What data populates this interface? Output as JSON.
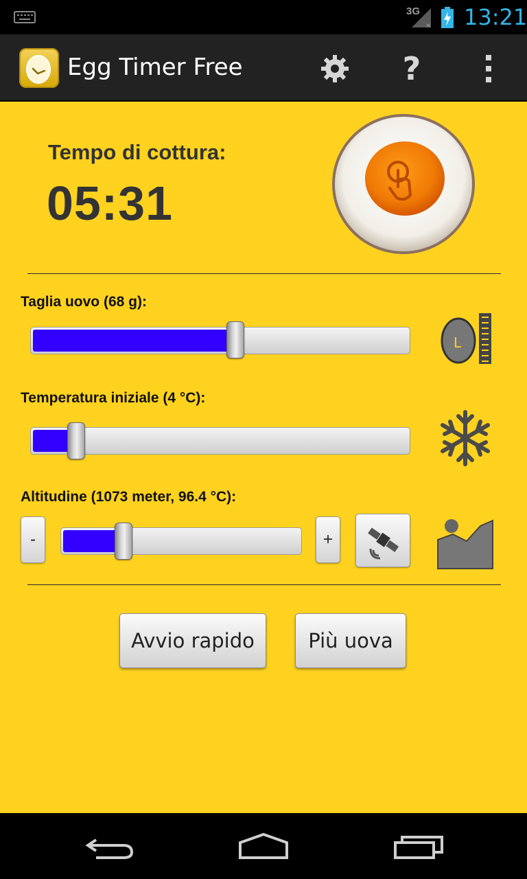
{
  "status_bar": {
    "network_type": "3G",
    "time": "13:21",
    "icons": [
      "keyboard-icon",
      "signal-icon",
      "battery-charging-icon"
    ],
    "time_color": "#33b5e5"
  },
  "action_bar": {
    "title": "Egg Timer Free",
    "actions": [
      "settings-icon",
      "help-icon",
      "overflow-menu-icon"
    ],
    "help_glyph": "?"
  },
  "timer": {
    "label": "Tempo di cottura:",
    "value": "05:31"
  },
  "egg_size": {
    "label": "Taglia uovo (68 g):",
    "level_fraction": 0.54,
    "size_badge": "L",
    "icon": "egg-size-icon"
  },
  "start_temperature": {
    "label": "Temperatura iniziale (4 °C):",
    "level_fraction": 0.12,
    "icon": "snowflake-icon"
  },
  "altitude": {
    "label": "Altitudine (1073 meter, 96.4 °C):",
    "level_fraction": 0.26,
    "minus_label": "-",
    "plus_label": "+",
    "gps_icon": "satellite-icon",
    "icon": "mountain-icon"
  },
  "buttons": {
    "quick_start": "Avvio rapido",
    "more_eggs": "Più uova"
  },
  "nav_bar": {
    "icons": [
      "back-icon",
      "home-icon",
      "recent-apps-icon"
    ]
  },
  "colors": {
    "background": "#ffd21f",
    "slider_fill": "#3300ff",
    "action_bar": "#222222"
  }
}
